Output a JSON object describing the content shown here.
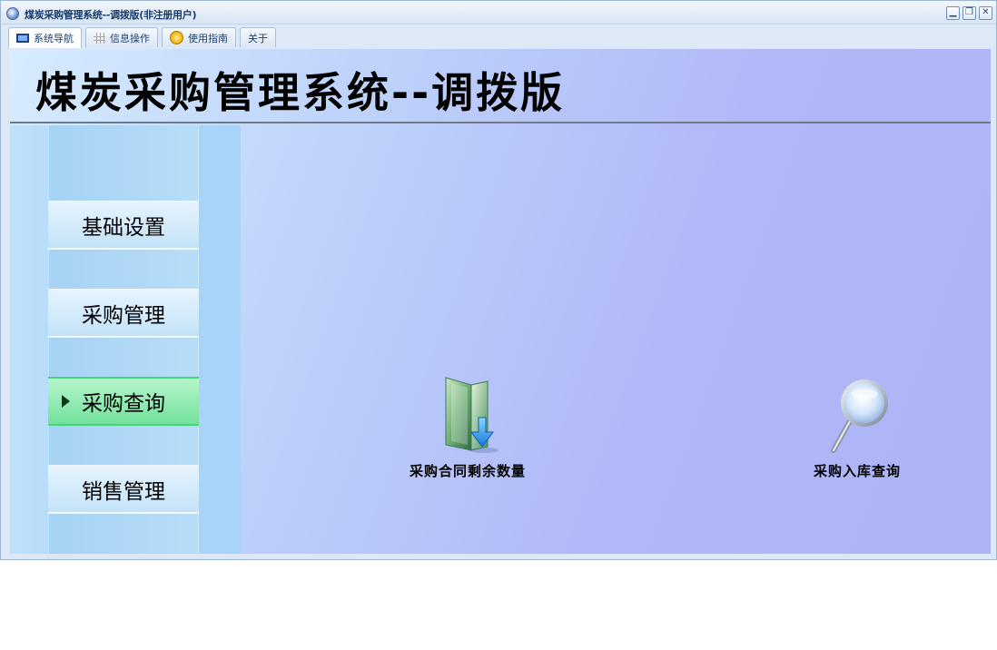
{
  "window": {
    "title": "煤炭采购管理系统--调拨版(非注册用户)",
    "controls": {
      "minimize": "▁",
      "restore": "❐",
      "close": "✕"
    }
  },
  "tabs": [
    {
      "label": "系统导航",
      "icon": "monitor-icon",
      "active": true
    },
    {
      "label": "信息操作",
      "icon": "grid-icon",
      "active": false
    },
    {
      "label": "使用指南",
      "icon": "help-icon",
      "active": false
    },
    {
      "label": "关于",
      "icon": "",
      "active": false
    }
  ],
  "header": {
    "title": "煤炭采购管理系统--调拨版"
  },
  "sidebar": {
    "items": [
      {
        "label": "基础设置",
        "active": false
      },
      {
        "label": "采购管理",
        "active": false
      },
      {
        "label": "采购查询",
        "active": true
      },
      {
        "label": "销售管理",
        "active": false
      }
    ]
  },
  "functions": [
    {
      "label": "采购合同剩余数量",
      "icon": "folder-download-icon"
    },
    {
      "label": "采购入库查询",
      "icon": "magnifier-icon"
    }
  ],
  "colors": {
    "active_nav": "#72e19c",
    "title_bar_text": "#163a6c"
  }
}
